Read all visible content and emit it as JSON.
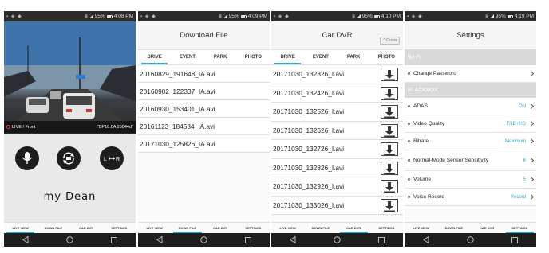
{
  "status": {
    "p1": {
      "battery": "95%",
      "time": "4:08 PM"
    },
    "p2": {
      "battery": "95%",
      "time": "4:09 PM"
    },
    "p3": {
      "battery": "95%",
      "time": "4:10 PM"
    },
    "p4": {
      "battery": "95%",
      "time": "4:19 PM"
    }
  },
  "live": {
    "label": "LIVE / Front",
    "info": "\"BP10.0A 26044d\"",
    "logo": "my Dean"
  },
  "download": {
    "title": "Download File",
    "tabs": [
      "DRIVE",
      "EVENT",
      "PARK",
      "PHOTO"
    ],
    "files": [
      "20160829_191648_IA.avi",
      "20160902_122337_IA.avi",
      "20160930_153401_IA.avi",
      "20161123_184534_IA.avi",
      "20171030_125826_IA.avi"
    ]
  },
  "cardvr": {
    "title": "Car DVR",
    "order_label": "Order",
    "tabs": [
      "DRIVE",
      "EVENT",
      "PARK",
      "PHOTO"
    ],
    "files": [
      "20171030_132326_I.avi",
      "20171030_132426_I.avi",
      "20171030_132526_I.avi",
      "20171030_132626_I.avi",
      "20171030_132726_I.avi",
      "20171030_132826_I.avi",
      "20171030_132926_I.avi",
      "20171030_133026_I.avi"
    ]
  },
  "settings": {
    "title": "Settings",
    "wifi_header": "Wi-Fi",
    "change_password": "Change Password",
    "blackbox_header": "BLACKBOX",
    "items": [
      {
        "label": "ADAS",
        "value": "ON"
      },
      {
        "label": "Video Quality",
        "value": "FHD+HD"
      },
      {
        "label": "Bitrate",
        "value": "Maximum"
      },
      {
        "label": "Normal-Mode Sensor Sensitivity",
        "value": "6"
      },
      {
        "label": "Volume",
        "value": "5"
      },
      {
        "label": "Voice Record",
        "value": "Record"
      }
    ]
  },
  "bottom_nav": [
    "LIVE VIEW",
    "DOWN FILE",
    "CAR DVR",
    "SETTINGS"
  ],
  "colors": {
    "accent": "#3aa6c8",
    "status_bar": "#2b2b2b",
    "nav_bar": "#1e1e1e"
  }
}
